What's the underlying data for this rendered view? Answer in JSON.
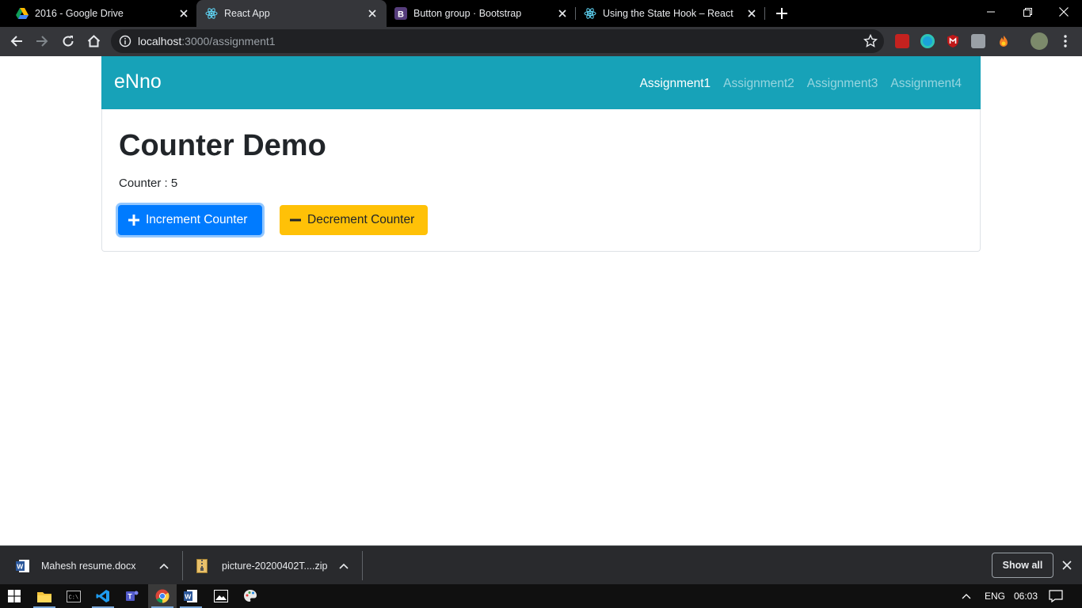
{
  "browser": {
    "tabs": [
      {
        "title": "2016 - Google Drive",
        "favicon": "google-drive-icon",
        "active": false
      },
      {
        "title": "React App",
        "favicon": "react-icon",
        "active": true
      },
      {
        "title": "Button group · Bootstrap",
        "favicon": "bootstrap-icon",
        "active": false
      },
      {
        "title": "Using the State Hook – React",
        "favicon": "react-icon",
        "active": false
      }
    ],
    "url_host": "localhost",
    "url_path": ":3000/assignment1"
  },
  "navbar": {
    "brand": "eNno",
    "links": [
      {
        "label": "Assignment1",
        "active": true
      },
      {
        "label": "Assignment2",
        "active": false
      },
      {
        "label": "Assignment3",
        "active": false
      },
      {
        "label": "Assignment4",
        "active": false
      }
    ],
    "color": "#17a2b8"
  },
  "main": {
    "title": "Counter Demo",
    "counter_label": "Counter : ",
    "counter_value": "5",
    "increment_label": "Increment Counter",
    "decrement_label": "Decrement Counter",
    "increment_color": "#007bff",
    "decrement_color": "#ffc107"
  },
  "downloads": {
    "items": [
      {
        "name": "Mahesh resume.docx",
        "icon": "word-doc-icon"
      },
      {
        "name": "picture-20200402T....zip",
        "icon": "zip-file-icon"
      }
    ],
    "show_all": "Show all"
  },
  "taskbar": {
    "lang": "ENG",
    "time": "06:03"
  }
}
